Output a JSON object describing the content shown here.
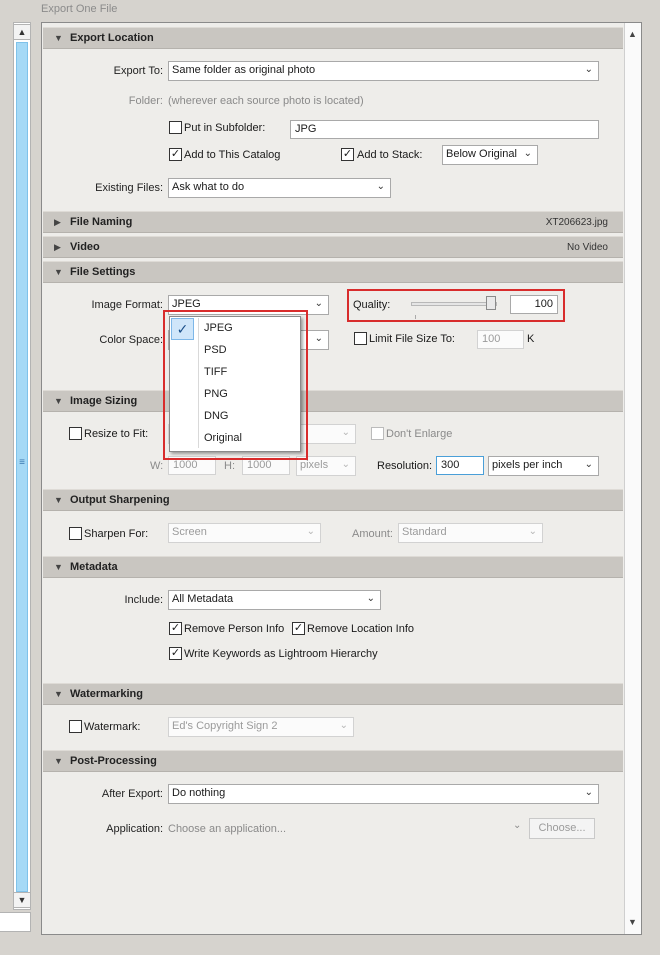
{
  "window": {
    "title": "Export One File"
  },
  "sections": {
    "export_location": {
      "title": "Export Location"
    },
    "file_naming": {
      "title": "File Naming",
      "summary": "XT206623.jpg"
    },
    "video": {
      "title": "Video",
      "summary": "No Video"
    },
    "file_settings": {
      "title": "File Settings"
    },
    "image_sizing": {
      "title": "Image Sizing"
    },
    "output_sharpening": {
      "title": "Output Sharpening"
    },
    "metadata": {
      "title": "Metadata"
    },
    "watermarking": {
      "title": "Watermarking"
    },
    "post_processing": {
      "title": "Post-Processing"
    }
  },
  "export_location": {
    "export_to_label": "Export To:",
    "export_to_value": "Same folder as original photo",
    "folder_label": "Folder:",
    "folder_value": "(wherever each source photo is located)",
    "subfolder_label": "Put in Subfolder:",
    "subfolder_checked": false,
    "subfolder_value": "JPG",
    "add_catalog_label": "Add to This Catalog",
    "add_catalog_checked": true,
    "add_stack_label": "Add to Stack:",
    "add_stack_checked": true,
    "stack_position": "Below Original",
    "existing_files_label": "Existing Files:",
    "existing_files_value": "Ask what to do"
  },
  "file_settings": {
    "image_format_label": "Image Format:",
    "image_format_value": "JPEG",
    "color_space_label": "Color Space:",
    "quality_label": "Quality:",
    "quality_value": "100",
    "limit_size_label": "Limit File Size To:",
    "limit_size_checked": false,
    "limit_size_value": "100",
    "limit_size_unit": "K",
    "format_options": [
      "JPEG",
      "PSD",
      "TIFF",
      "PNG",
      "DNG",
      "Original"
    ],
    "format_selected": "JPEG"
  },
  "image_sizing": {
    "resize_label": "Resize to Fit:",
    "resize_checked": false,
    "dont_enlarge_label": "Don't Enlarge",
    "w_label": "W:",
    "w_value": "1000",
    "h_label": "H:",
    "h_value": "1000",
    "unit_value": "pixels",
    "resolution_label": "Resolution:",
    "resolution_value": "300",
    "resolution_unit": "pixels per inch"
  },
  "output_sharpening": {
    "sharpen_label": "Sharpen For:",
    "sharpen_checked": false,
    "sharpen_value": "Screen",
    "amount_label": "Amount:",
    "amount_value": "Standard"
  },
  "metadata": {
    "include_label": "Include:",
    "include_value": "All Metadata",
    "remove_person_label": "Remove Person Info",
    "remove_location_label": "Remove Location Info",
    "write_keywords_label": "Write Keywords as Lightroom Hierarchy"
  },
  "watermarking": {
    "watermark_label": "Watermark:",
    "watermark_checked": false,
    "watermark_value": "Ed's Copyright Sign 2"
  },
  "post_processing": {
    "after_export_label": "After Export:",
    "after_export_value": "Do nothing",
    "application_label": "Application:",
    "application_placeholder": "Choose an application...",
    "choose_button": "Choose..."
  },
  "icons": {
    "triangle_down": "▼",
    "triangle_right": "▶",
    "chevron": "⌄",
    "check": "✓",
    "scroll_up": "▲",
    "scroll_down": "▼",
    "grip": "≡"
  },
  "colors": {
    "highlight_box": "#d82c2c",
    "accent": "#4a9fd8"
  }
}
